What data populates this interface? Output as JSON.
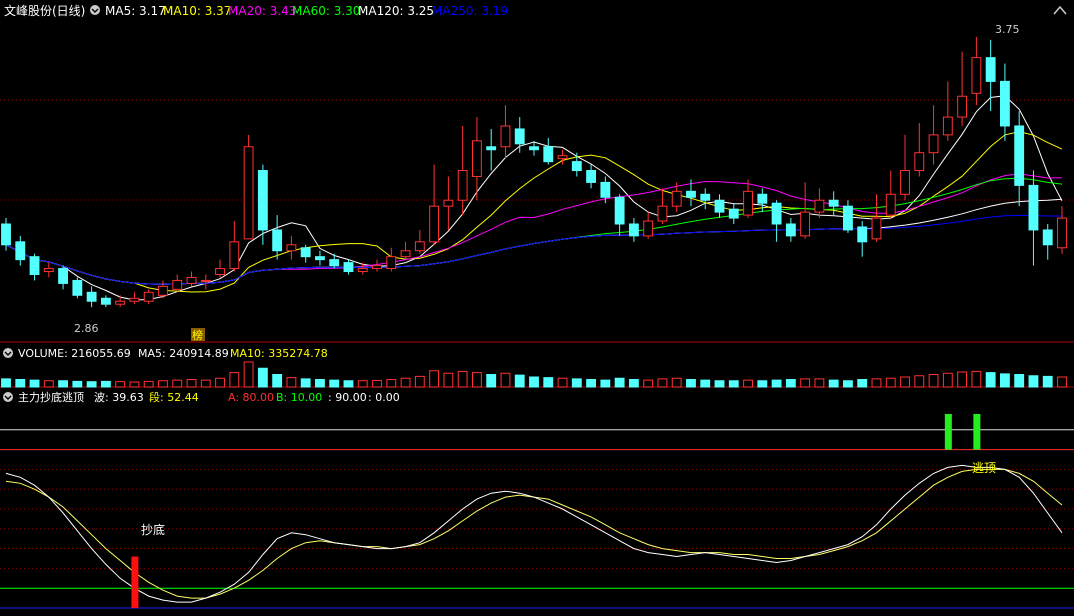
{
  "header": {
    "title": "文峰股份(日线)",
    "ma": [
      {
        "label": "MA5: 3.17",
        "color": "#ffffff"
      },
      {
        "label": "MA10: 3.37",
        "color": "#ffff00"
      },
      {
        "label": "MA20: 3.43",
        "color": "#ff00ff"
      },
      {
        "label": "MA60: 3.30",
        "color": "#00ff00"
      },
      {
        "label": "MA120: 3.25",
        "color": "#ffffff"
      },
      {
        "label": "MA250: 3.19",
        "color": "#0000ff"
      }
    ]
  },
  "price_panel": {
    "high_label": "3.75",
    "low_label": "2.86",
    "badge": "榜"
  },
  "volume_panel": {
    "values": [
      {
        "label": "VOLUME: 216055.69",
        "color": "#ffffff"
      },
      {
        "label": "MA5: 240914.89",
        "color": "#ffffff"
      },
      {
        "label": "MA10: 335274.78",
        "color": "#ffff00"
      }
    ]
  },
  "indicator_panel": {
    "title": "主力抄底逃顶",
    "values": [
      {
        "label": "波: 39.63",
        "color": "#ffffff"
      },
      {
        "label": "段: 52.44",
        "color": "#ffff00"
      },
      {
        "label": "A: 80.00",
        "color": "#ff3030"
      },
      {
        "label": "B: 10.00",
        "color": "#00ff00"
      },
      {
        "label": ": 90.00",
        "color": "#ffffff"
      },
      {
        "label": ": 0.00",
        "color": "#ffffff"
      }
    ],
    "buy_label": "抄底",
    "sell_label": "逃顶"
  },
  "colors": {
    "up": "#ff3232",
    "down": "#54ffff",
    "grid": "#8b0000",
    "frame": "#b40000"
  },
  "chart_data": {
    "type": "candlestick",
    "title": "文峰股份(日线)",
    "ylim": [
      2.78,
      3.8
    ],
    "candles": [
      [
        3.12,
        3.05,
        3.14,
        3.03
      ],
      [
        3.06,
        3.0,
        3.08,
        2.98
      ],
      [
        3.01,
        2.95,
        3.02,
        2.93
      ],
      [
        2.96,
        2.97,
        2.99,
        2.94
      ],
      [
        2.97,
        2.92,
        2.98,
        2.9
      ],
      [
        2.93,
        2.88,
        2.94,
        2.87
      ],
      [
        2.89,
        2.86,
        2.91,
        2.84
      ],
      [
        2.87,
        2.85,
        2.88,
        2.84
      ],
      [
        2.85,
        2.86,
        2.88,
        2.84
      ],
      [
        2.86,
        2.87,
        2.89,
        2.85
      ],
      [
        2.86,
        2.89,
        2.9,
        2.85
      ],
      [
        2.88,
        2.91,
        2.93,
        2.87
      ],
      [
        2.9,
        2.93,
        2.95,
        2.89
      ],
      [
        2.92,
        2.94,
        2.96,
        2.91
      ],
      [
        2.93,
        2.93,
        2.95,
        2.9
      ],
      [
        2.95,
        2.97,
        3.0,
        2.94
      ],
      [
        2.97,
        3.06,
        3.13,
        2.96
      ],
      [
        3.07,
        3.38,
        3.42,
        3.07
      ],
      [
        3.3,
        3.1,
        3.32,
        3.05
      ],
      [
        3.1,
        3.03,
        3.15,
        3.0
      ],
      [
        3.03,
        3.05,
        3.08,
        3.0
      ],
      [
        3.04,
        3.01,
        3.05,
        2.99
      ],
      [
        3.01,
        3.0,
        3.03,
        2.98
      ],
      [
        3.0,
        2.98,
        3.02,
        2.97
      ],
      [
        2.99,
        2.96,
        3.0,
        2.95
      ],
      [
        2.96,
        2.97,
        2.99,
        2.95
      ],
      [
        2.97,
        2.98,
        3.0,
        2.96
      ],
      [
        2.97,
        3.01,
        3.04,
        2.96
      ],
      [
        3.01,
        3.03,
        3.06,
        3.0
      ],
      [
        3.03,
        3.06,
        3.1,
        3.02
      ],
      [
        3.06,
        3.18,
        3.32,
        3.05
      ],
      [
        3.18,
        3.2,
        3.28,
        3.1
      ],
      [
        3.2,
        3.3,
        3.45,
        3.15
      ],
      [
        3.28,
        3.4,
        3.48,
        3.2
      ],
      [
        3.38,
        3.37,
        3.44,
        3.3
      ],
      [
        3.38,
        3.45,
        3.52,
        3.34
      ],
      [
        3.44,
        3.39,
        3.48,
        3.36
      ],
      [
        3.38,
        3.37,
        3.4,
        3.35
      ],
      [
        3.38,
        3.33,
        3.41,
        3.32
      ],
      [
        3.34,
        3.35,
        3.37,
        3.32
      ],
      [
        3.33,
        3.3,
        3.36,
        3.28
      ],
      [
        3.3,
        3.26,
        3.32,
        3.24
      ],
      [
        3.26,
        3.21,
        3.28,
        3.19
      ],
      [
        3.21,
        3.12,
        3.22,
        3.08
      ],
      [
        3.12,
        3.08,
        3.14,
        3.06
      ],
      [
        3.08,
        3.13,
        3.16,
        3.07
      ],
      [
        3.13,
        3.18,
        3.24,
        3.12
      ],
      [
        3.18,
        3.23,
        3.26,
        3.16
      ],
      [
        3.23,
        3.21,
        3.27,
        3.18
      ],
      [
        3.22,
        3.2,
        3.24,
        3.17
      ],
      [
        3.2,
        3.16,
        3.22,
        3.14
      ],
      [
        3.17,
        3.14,
        3.19,
        3.12
      ],
      [
        3.15,
        3.23,
        3.27,
        3.14
      ],
      [
        3.22,
        3.19,
        3.24,
        3.16
      ],
      [
        3.19,
        3.12,
        3.2,
        3.06
      ],
      [
        3.12,
        3.08,
        3.14,
        3.06
      ],
      [
        3.08,
        3.16,
        3.26,
        3.07
      ],
      [
        3.16,
        3.2,
        3.24,
        3.14
      ],
      [
        3.2,
        3.18,
        3.23,
        3.15
      ],
      [
        3.18,
        3.1,
        3.2,
        3.09
      ],
      [
        3.11,
        3.06,
        3.13,
        3.01
      ],
      [
        3.07,
        3.14,
        3.22,
        3.06
      ],
      [
        3.15,
        3.22,
        3.3,
        3.14
      ],
      [
        3.22,
        3.3,
        3.42,
        3.2
      ],
      [
        3.3,
        3.36,
        3.46,
        3.28
      ],
      [
        3.36,
        3.42,
        3.52,
        3.32
      ],
      [
        3.42,
        3.48,
        3.6,
        3.4
      ],
      [
        3.48,
        3.55,
        3.7,
        3.45
      ],
      [
        3.56,
        3.68,
        3.75,
        3.52
      ],
      [
        3.68,
        3.6,
        3.74,
        3.5
      ],
      [
        3.6,
        3.45,
        3.66,
        3.4
      ],
      [
        3.45,
        3.25,
        3.5,
        3.18
      ],
      [
        3.25,
        3.1,
        3.3,
        2.98
      ],
      [
        3.1,
        3.05,
        3.12,
        3.0
      ],
      [
        3.04,
        3.14,
        3.18,
        3.02
      ]
    ],
    "volume": [
      26,
      24,
      22,
      20,
      20,
      18,
      17,
      18,
      17,
      16,
      18,
      20,
      22,
      24,
      22,
      28,
      46,
      80,
      60,
      40,
      30,
      26,
      24,
      22,
      20,
      20,
      21,
      24,
      28,
      34,
      52,
      44,
      50,
      46,
      40,
      44,
      38,
      32,
      30,
      28,
      26,
      24,
      22,
      28,
      24,
      22,
      26,
      28,
      24,
      22,
      20,
      20,
      22,
      20,
      22,
      24,
      26,
      26,
      22,
      20,
      24,
      26,
      28,
      32,
      36,
      40,
      44,
      48,
      50,
      46,
      42,
      40,
      36,
      34,
      32
    ],
    "wave": [
      68,
      66,
      62,
      56,
      48,
      39,
      30,
      22,
      15,
      10,
      6,
      4,
      3,
      3,
      5,
      8,
      12,
      18,
      27,
      35,
      38,
      37,
      35,
      33,
      32,
      31,
      30,
      30,
      31,
      33,
      38,
      44,
      50,
      55,
      58,
      59,
      58,
      56,
      53,
      50,
      46,
      42,
      38,
      34,
      30,
      28,
      27,
      26,
      27,
      28,
      27,
      26,
      25,
      24,
      23,
      24,
      26,
      28,
      30,
      32,
      36,
      42,
      50,
      57,
      63,
      68,
      71,
      72,
      71,
      71,
      70,
      66,
      58,
      48,
      38
    ],
    "band": [
      64,
      63,
      60,
      56,
      51,
      44,
      37,
      30,
      24,
      18,
      13,
      9,
      6,
      5,
      5,
      7,
      10,
      14,
      19,
      25,
      30,
      33,
      34,
      33,
      32,
      31,
      31,
      30,
      31,
      32,
      35,
      39,
      44,
      49,
      53,
      56,
      57,
      56,
      55,
      52,
      49,
      46,
      42,
      38,
      35,
      32,
      30,
      29,
      28,
      28,
      28,
      27,
      27,
      26,
      25,
      25,
      26,
      27,
      29,
      31,
      34,
      38,
      44,
      50,
      56,
      62,
      66,
      69,
      70,
      70,
      70,
      68,
      64,
      58,
      52
    ],
    "ref_lines": {
      "A": 80,
      "B": 10,
      "top": 90,
      "bottom": 0
    },
    "buy_index": 9,
    "sell_indices": [
      66,
      68
    ]
  }
}
